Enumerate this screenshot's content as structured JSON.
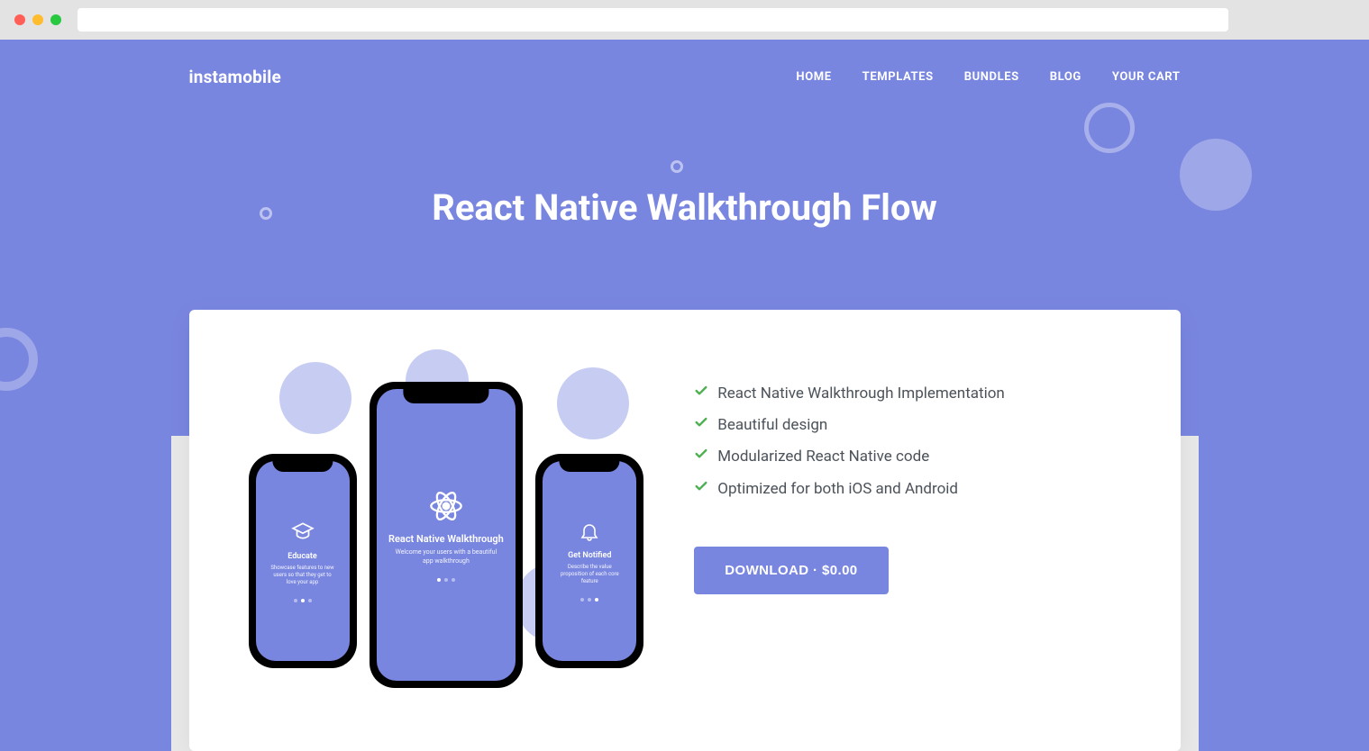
{
  "nav": {
    "logo": "instamobile",
    "items": [
      "HOME",
      "TEMPLATES",
      "BUNDLES",
      "BLOG",
      "YOUR CART"
    ]
  },
  "hero": {
    "title": "React Native Walkthrough Flow"
  },
  "features": [
    "React Native Walkthrough Implementation",
    "Beautiful design",
    "Modularized React Native code",
    "Optimized for both iOS and Android"
  ],
  "cta": {
    "label": "DOWNLOAD · $0.00"
  },
  "phones": {
    "center": {
      "title": "React Native Walkthrough",
      "subtitle": "Welcome your users with a beautiful app walkthrough"
    },
    "left": {
      "title": "Educate",
      "subtitle": "Showcase features to new users so that they get to love your app"
    },
    "right": {
      "title": "Get Notified",
      "subtitle": "Describe the value proposition of each core feature"
    }
  }
}
